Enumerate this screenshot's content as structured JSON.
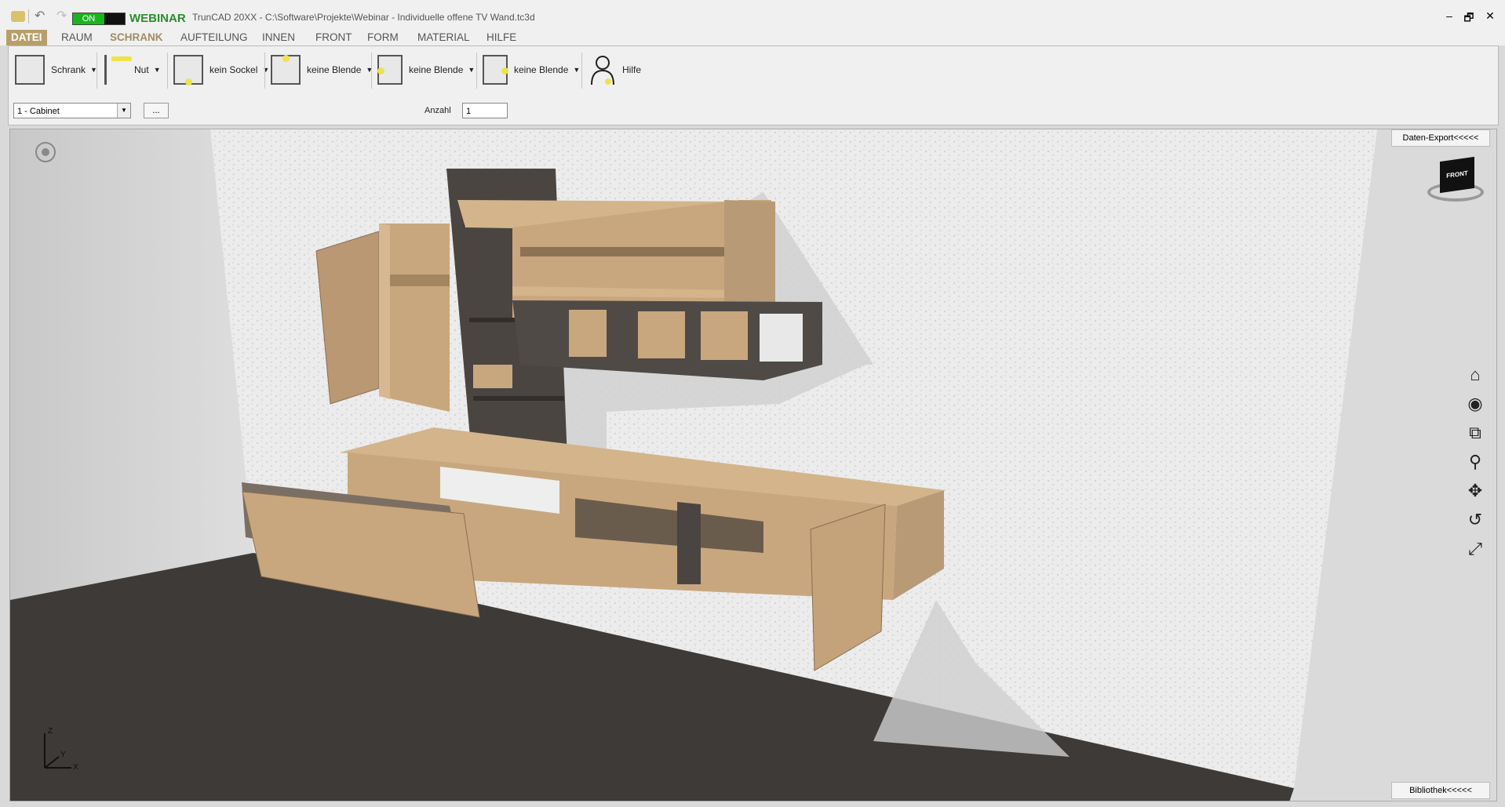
{
  "titlebar": {
    "toggle_on": "ON",
    "brand": "WEBINAR",
    "title": "TrunCAD 20XX - C:\\Software\\Projekte\\Webinar - Individuelle offene TV Wand.tc3d",
    "minimize": "–",
    "restore": "🗗",
    "close": "✕"
  },
  "menu": {
    "items": [
      "DATEI",
      "RAUM",
      "SCHRANK",
      "AUFTEILUNG",
      "INNEN",
      "FRONT",
      "FORM",
      "MATERIAL",
      "HILFE"
    ]
  },
  "ribbon": {
    "schrank": "Schrank",
    "nut": "Nut",
    "sockel": "kein Sockel",
    "blende1": "keine Blende",
    "blende2": "keine Blende",
    "blende3": "keine Blende",
    "hilfe": "Hilfe",
    "cabinet_select": "1 - Cabinet",
    "more": "...",
    "anzahl_label": "Anzahl",
    "anzahl_value": "1"
  },
  "viewport": {
    "export": "Daten-Export<<<<<",
    "library": "Bibliothek<<<<<",
    "navcube_label": "FRONT",
    "axes": {
      "z": "Z",
      "y": "Y",
      "x": "X"
    }
  },
  "colors": {
    "accent": "#b89f6a",
    "oak": "#c9a77e",
    "dark_wood": "#4a4541",
    "floor": "#3d3a37"
  }
}
